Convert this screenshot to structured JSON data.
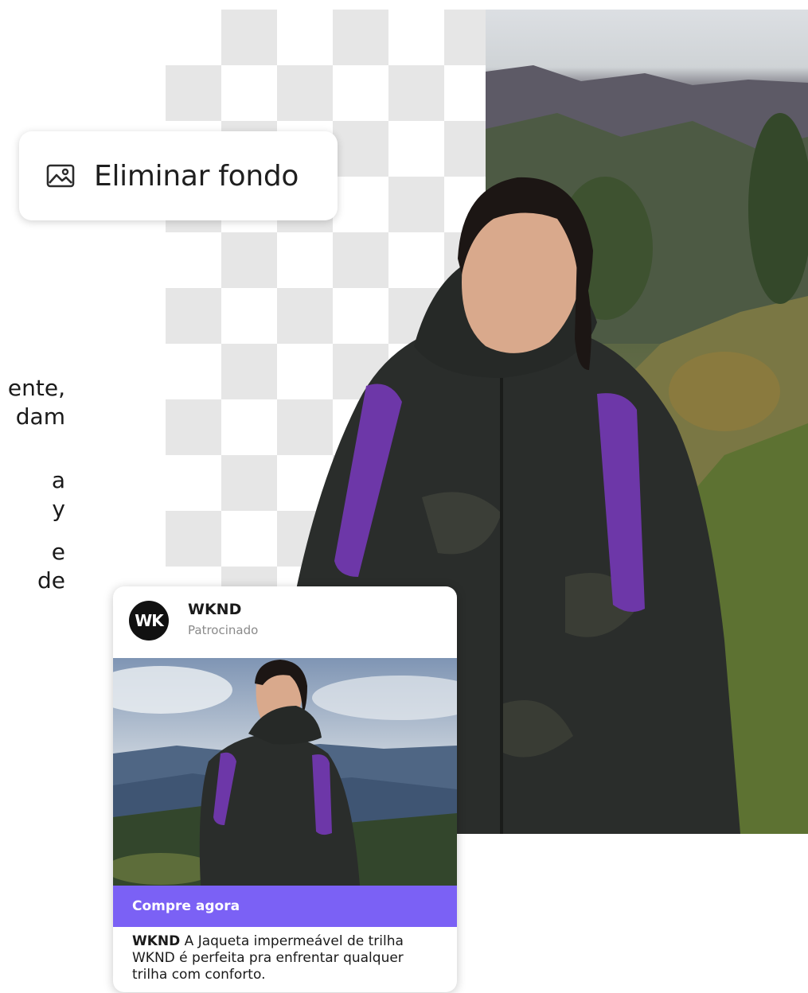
{
  "side_text": {
    "paragraph1": [
      "ente,",
      "dam"
    ],
    "paragraph2": [
      "a",
      "y"
    ],
    "paragraph3": [
      "e",
      "de"
    ]
  },
  "remove_background": {
    "label": "Eliminar fondo",
    "icon": "image-icon"
  },
  "ad_card": {
    "avatar_text": "WK",
    "brand": "WKND",
    "sponsored": "Patrocinado",
    "cta": "Compre agora",
    "caption_brand": "WKND",
    "caption_text": " A Jaqueta impermeável de trilha WKND é perfeita pra enfrentar qualquer trilha com conforto."
  },
  "colors": {
    "cta_bg": "#7b61f5",
    "checker": "#e6e6e6"
  }
}
